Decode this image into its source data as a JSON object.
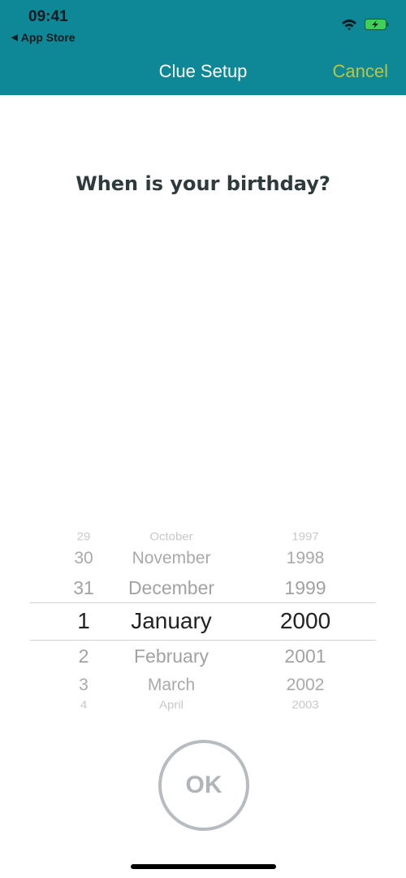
{
  "status_bar": {
    "time": "09:41",
    "back_label": "App Store"
  },
  "nav": {
    "title": "Clue Setup",
    "cancel_label": "Cancel"
  },
  "question": "When is your birthday?",
  "picker": {
    "days": [
      "29",
      "30",
      "31",
      "1",
      "2",
      "3",
      "4"
    ],
    "months": [
      "October",
      "November",
      "December",
      "January",
      "February",
      "March",
      "April"
    ],
    "years": [
      "1997",
      "1998",
      "1999",
      "2000",
      "2001",
      "2002",
      "2003"
    ],
    "selected": {
      "day": "1",
      "month": "January",
      "year": "2000"
    }
  },
  "ok_label": "OK",
  "colors": {
    "header": "#0e8796",
    "cancel": "#b6c64a",
    "ok": "#b8bcc0"
  }
}
